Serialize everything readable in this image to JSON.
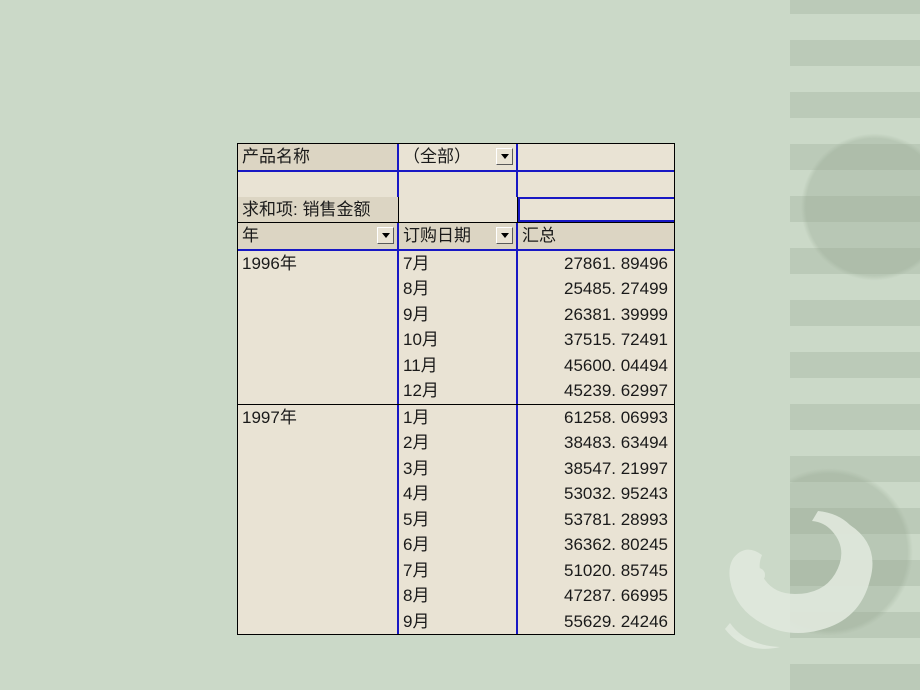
{
  "filter": {
    "field_label": "产品名称",
    "value": "（全部）"
  },
  "measure_label": "求和项: 销售金额",
  "headers": {
    "year": "年",
    "order_date": "订购日期",
    "total": "汇总"
  },
  "groups": [
    {
      "year": "1996年",
      "rows": [
        {
          "month": "7月",
          "value": "27861. 89496"
        },
        {
          "month": "8月",
          "value": "25485. 27499"
        },
        {
          "month": "9月",
          "value": "26381. 39999"
        },
        {
          "month": "10月",
          "value": "37515. 72491"
        },
        {
          "month": "11月",
          "value": "45600. 04494"
        },
        {
          "month": "12月",
          "value": "45239. 62997"
        }
      ]
    },
    {
      "year": "1997年",
      "rows": [
        {
          "month": "1月",
          "value": "61258. 06993"
        },
        {
          "month": "2月",
          "value": "38483. 63494"
        },
        {
          "month": "3月",
          "value": "38547. 21997"
        },
        {
          "month": "4月",
          "value": "53032. 95243"
        },
        {
          "month": "5月",
          "value": "53781. 28993"
        },
        {
          "month": "6月",
          "value": "36362. 80245"
        },
        {
          "month": "7月",
          "value": "51020. 85745"
        },
        {
          "month": "8月",
          "value": "47287. 66995"
        },
        {
          "month": "9月",
          "value": "55629. 24246"
        }
      ]
    }
  ]
}
